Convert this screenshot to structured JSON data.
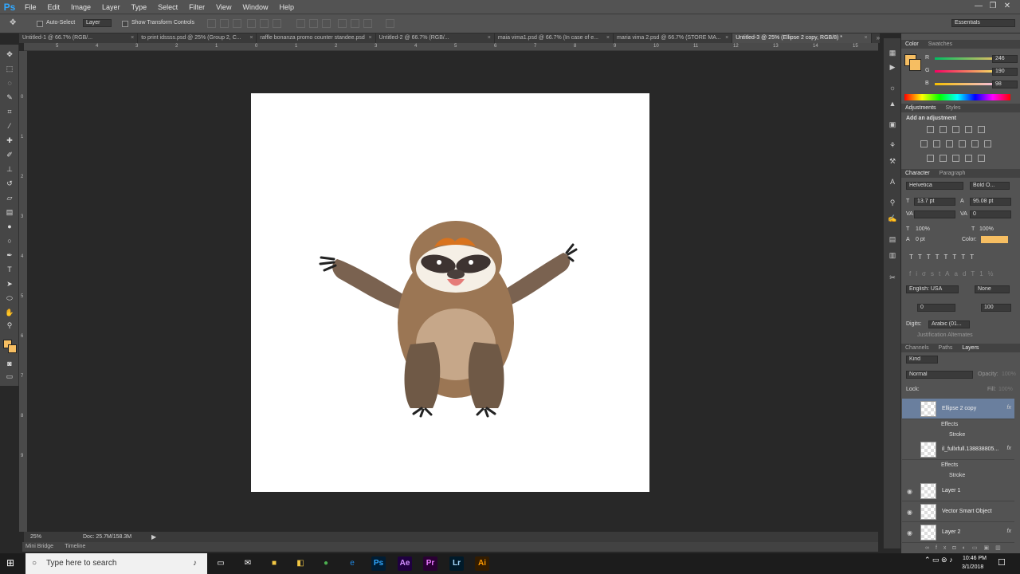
{
  "app": {
    "logo": "Ps",
    "accent": "#31a8ff"
  },
  "menu": [
    "File",
    "Edit",
    "Image",
    "Layer",
    "Type",
    "Select",
    "Filter",
    "View",
    "Window",
    "Help"
  ],
  "window_controls": [
    "—",
    "❐",
    "✕"
  ],
  "options": {
    "auto_select_label": "Auto-Select",
    "auto_select_value": "Layer",
    "transform_label": "Show Transform Controls",
    "workspace": "Essentials"
  },
  "tabs": [
    {
      "label": "Untitled-1 @ 66.7% (RGB/...",
      "active": false
    },
    {
      "label": "to print idssss.psd @ 25% (Group 2, C...",
      "active": false
    },
    {
      "label": "raffle bonanza promo counter standee.psd",
      "active": false
    },
    {
      "label": "Untitled-2 @ 66.7% (RGB/...",
      "active": false
    },
    {
      "label": "maia vima1.psd @ 66.7% (In case of e...",
      "active": false
    },
    {
      "label": "maria vima 2.psd @ 66.7% (STORE MA...",
      "active": false
    },
    {
      "label": "Untitled-3 @ 25% (Ellipse 2 copy, RGB/8) *",
      "active": true
    }
  ],
  "ruler_top": [
    "5",
    "4",
    "3",
    "2",
    "1",
    "0",
    "1",
    "2",
    "3",
    "4",
    "5",
    "6",
    "7",
    "8",
    "9",
    "10",
    "11",
    "12",
    "13",
    "14",
    "15"
  ],
  "ruler_left": [
    "0",
    "1",
    "2",
    "3",
    "4",
    "5",
    "6",
    "7",
    "8",
    "9"
  ],
  "status": {
    "zoom": "25%",
    "doc": "Doc: 25.7M/158.3M"
  },
  "bottom_tabs": [
    "Mini Bridge",
    "Timeline"
  ],
  "color_panel": {
    "tabs": [
      "Color",
      "Swatches"
    ],
    "r": "246",
    "g": "190",
    "b": "98",
    "r_label": "R",
    "g_label": "G",
    "b_label": "B",
    "fg": "#f6be62"
  },
  "adjustments": {
    "tabs": [
      "Adjustments",
      "Styles"
    ],
    "hint": "Add an adjustment"
  },
  "character": {
    "tabs": [
      "Character",
      "Paragraph"
    ],
    "font": "Helvetica",
    "style": "Bold O...",
    "size": "13.7 pt",
    "leading": "95.08 pt",
    "kerning": "",
    "tracking": "0",
    "vscale": "100%",
    "hscale": "100%",
    "baseline": "0 pt",
    "color_label": "Color:",
    "language": "English: USA",
    "aa": "None",
    "left_indent": "0",
    "right_val": "100",
    "digits_label": "Digits:",
    "digits": "Arabic (01...",
    "justification": "Justification Alternates"
  },
  "layers_panel": {
    "tabs": [
      "Channels",
      "Paths",
      "Layers"
    ],
    "kind": "Kind",
    "blend": "Normal",
    "opacity_label": "Opacity:",
    "opacity": "100%",
    "lock_label": "Lock:",
    "fill_label": "Fill:",
    "fill": "100%",
    "layers": [
      {
        "name": "Ellipse 2 copy",
        "fx": "fx",
        "selected": true,
        "visible": false,
        "effects_label": "Effects",
        "stroke_label": "Stroke"
      },
      {
        "name": "il_fullxfull.138838805...",
        "fx": "fx",
        "selected": false,
        "visible": false,
        "effects_label": "Effects",
        "stroke_label": "Stroke"
      },
      {
        "name": "Layer 1",
        "fx": "",
        "selected": false,
        "visible": true
      },
      {
        "name": "Vector Smart Object",
        "fx": "",
        "selected": false,
        "visible": true
      },
      {
        "name": "Layer 2",
        "fx": "fx",
        "selected": false,
        "visible": true
      }
    ]
  },
  "taskbar": {
    "search_placeholder": "Type here to search",
    "time": "10:46 PM",
    "date": "3/1/2018"
  }
}
